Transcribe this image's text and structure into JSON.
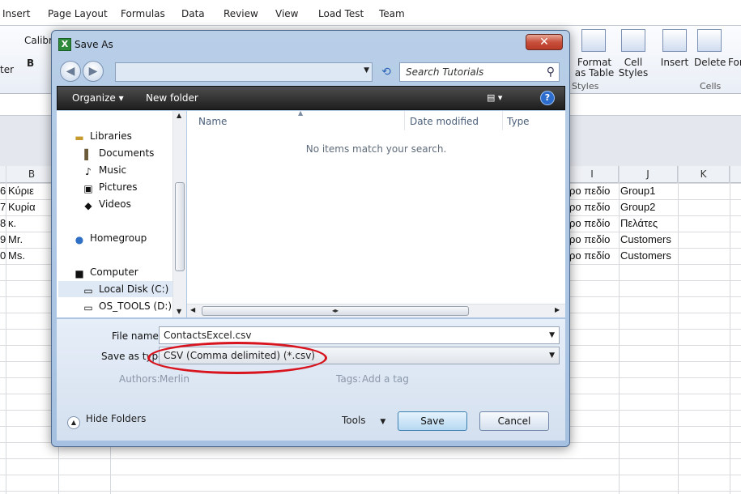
{
  "ribbon": {
    "tabs": [
      "Insert",
      "Page Layout",
      "Formulas",
      "Data",
      "Review",
      "View",
      "Load Test",
      "Team"
    ],
    "font_name": "Calibri",
    "left_partial": "ter",
    "format_as_table": [
      "Format",
      "as Table"
    ],
    "cell_styles": [
      "Cell",
      "Styles"
    ],
    "styles_group": "Styles",
    "insert": "Insert",
    "delete": "Delete",
    "format_partial": "For",
    "cells_group": "Cells"
  },
  "sheet": {
    "columns": [
      "B",
      "I",
      "J",
      "K"
    ],
    "rows": [
      {
        "a": "6",
        "b": "Κύριε",
        "i": "ρο πεδίο",
        "j": "Group1"
      },
      {
        "a": "7",
        "b": "Κυρία",
        "i": "ρο πεδίο",
        "j": "Group2"
      },
      {
        "a": "8",
        "b": "κ.",
        "i": "ρο πεδίο",
        "j": "Πελάτες"
      },
      {
        "a": "9",
        "b": "Mr.",
        "i": "ρο πεδίο",
        "j": "Customers"
      },
      {
        "a": "0",
        "b": "Ms.",
        "i": "ρο πεδίο",
        "j": "Customers"
      }
    ]
  },
  "dialog": {
    "title": "Save As",
    "app_icon": "X",
    "close": "✕",
    "search_placeholder": "Search Tutorials",
    "toolbar": {
      "organize": "Organize ▾",
      "new_folder": "New folder",
      "help": "?"
    },
    "nav": {
      "libraries": "Libraries",
      "documents": "Documents",
      "music": "Music",
      "pictures": "Pictures",
      "videos": "Videos",
      "homegroup": "Homegroup",
      "computer": "Computer",
      "local_disk": "Local Disk (C:)",
      "os_tools": "OS_TOOLS (D:)"
    },
    "columns": {
      "name": "Name",
      "date_modified": "Date modified",
      "type": "Type"
    },
    "empty_message": "No items match your search.",
    "file_name_label": "File name:",
    "file_name_value": "ContactsExcel.csv",
    "save_type_label": "Save as type:",
    "save_type_value": "CSV (Comma delimited) (*.csv)",
    "authors_label": "Authors:",
    "authors_value": "Merlin",
    "tags_label": "Tags:",
    "tags_value": "Add a tag",
    "hide_folders": "Hide Folders",
    "tools": "Tools",
    "save": "Save",
    "cancel": "Cancel"
  },
  "colors": {
    "annotation": "#d8141e",
    "toolbar_bg": "#1e1e1e"
  }
}
